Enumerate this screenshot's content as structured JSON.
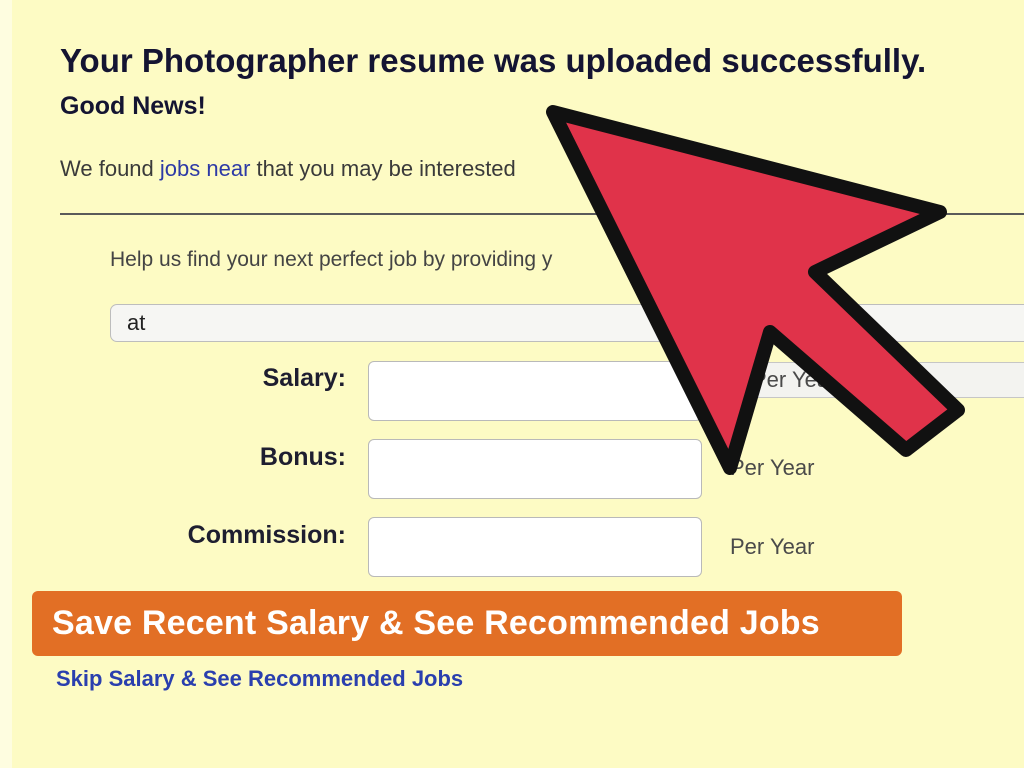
{
  "header": {
    "headline": "Your Photographer resume was uploaded successfully.",
    "subhead": "Good News!"
  },
  "found": {
    "prefix": "We found ",
    "link": "jobs near",
    "suffix": " that you may be interested"
  },
  "help": {
    "text": "Help us find your next perfect job by providing y"
  },
  "title_input": {
    "value": "at"
  },
  "form": {
    "salary_label": "Salary:",
    "bonus_label": "Bonus:",
    "commission_label": "Commission:",
    "salary_unit": "Per Year",
    "bonus_unit": "Per Year",
    "commission_unit": "Per Year"
  },
  "actions": {
    "save_label": "Save Recent Salary & See Recommended Jobs",
    "skip_label": "Skip Salary & See Recommended Jobs"
  },
  "colors": {
    "background": "#fdfbc4",
    "button": "#e26f25",
    "link": "#2a3fae",
    "arrow": "#e0334a"
  },
  "overlay": {
    "icon": "cursor-arrow-icon"
  }
}
